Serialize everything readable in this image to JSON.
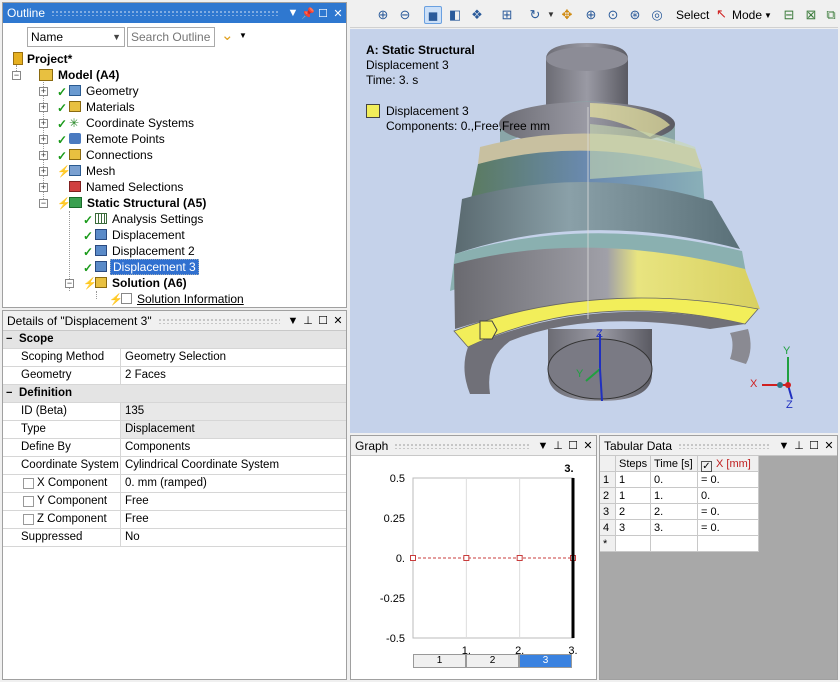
{
  "outline": {
    "title": "Outline",
    "name_select": "Name",
    "search_placeholder": "Search Outline",
    "tree": [
      {
        "label": "Project*",
        "bold": true
      },
      {
        "label": "Model (A4)",
        "bold": true
      },
      {
        "label": "Geometry"
      },
      {
        "label": "Materials"
      },
      {
        "label": "Coordinate Systems"
      },
      {
        "label": "Remote Points"
      },
      {
        "label": "Connections"
      },
      {
        "label": "Mesh"
      },
      {
        "label": "Named Selections"
      },
      {
        "label": "Static Structural (A5)",
        "bold": true
      },
      {
        "label": "Analysis Settings"
      },
      {
        "label": "Displacement"
      },
      {
        "label": "Displacement 2"
      },
      {
        "label": "Displacement 3",
        "selected": true
      },
      {
        "label": "Solution (A6)",
        "bold": true
      },
      {
        "label": "Solution Information"
      }
    ]
  },
  "details": {
    "title": "Details of \"Displacement 3\"",
    "rows": [
      {
        "key": "Scope",
        "type": "category"
      },
      {
        "key": "Scoping Method",
        "value": "Geometry Selection"
      },
      {
        "key": "Geometry",
        "value": "2 Faces"
      },
      {
        "key": "Definition",
        "type": "category"
      },
      {
        "key": "ID (Beta)",
        "value": "135",
        "gray": true
      },
      {
        "key": "Type",
        "value": "Displacement",
        "gray": true
      },
      {
        "key": "Define By",
        "value": "Components"
      },
      {
        "key": "Coordinate System",
        "value": "Cylindrical Coordinate System"
      },
      {
        "key": "X Component",
        "value": "0. mm  (ramped)",
        "checkbox": true
      },
      {
        "key": "Y Component",
        "value": "Free",
        "checkbox": true
      },
      {
        "key": "Z Component",
        "value": "Free",
        "checkbox": true
      },
      {
        "key": "Suppressed",
        "value": "No"
      }
    ]
  },
  "toolbar": {
    "select_label": "Select",
    "mode_label": "Mode"
  },
  "viewport": {
    "title": "A: Static Structural",
    "subtitle": "Displacement 3",
    "time": "Time: 3. s",
    "legend_label": "Displacement 3",
    "legend_components": "Components: 0.,Free,Free mm",
    "accent_color": "#f2ee5a",
    "background_color": "#c5d2ea",
    "triad": {
      "y": "Y",
      "x": "X",
      "z": "Z"
    },
    "body_axes": {
      "z": "Z",
      "y": "Y"
    }
  },
  "graph": {
    "title": "Graph",
    "y_ticks": [
      "0.5",
      "0.25",
      "0.",
      "-0.25",
      "-0.5"
    ],
    "x_ticks": [
      "1.",
      "2.",
      "3."
    ],
    "current_label": "3.",
    "step_tabs": [
      "1",
      "2",
      "3"
    ],
    "active_step": 3,
    "chart_data": {
      "type": "line",
      "x": [
        0,
        1,
        2,
        3
      ],
      "y": [
        0,
        0,
        0,
        0
      ],
      "ylim": [
        -0.5,
        0.5
      ],
      "xlim": [
        0,
        3
      ],
      "series_color": "#c83c3c"
    }
  },
  "tabular": {
    "title": "Tabular Data",
    "columns": [
      "Steps",
      "Time [s]",
      "X [mm]"
    ],
    "rows": [
      {
        "idx": "1",
        "step": "1",
        "time": "0.",
        "x": "= 0."
      },
      {
        "idx": "2",
        "step": "1",
        "time": "1.",
        "x": "0."
      },
      {
        "idx": "3",
        "step": "2",
        "time": "2.",
        "x": "= 0."
      },
      {
        "idx": "4",
        "step": "3",
        "time": "3.",
        "x": "= 0."
      }
    ],
    "new_row_marker": "*"
  }
}
